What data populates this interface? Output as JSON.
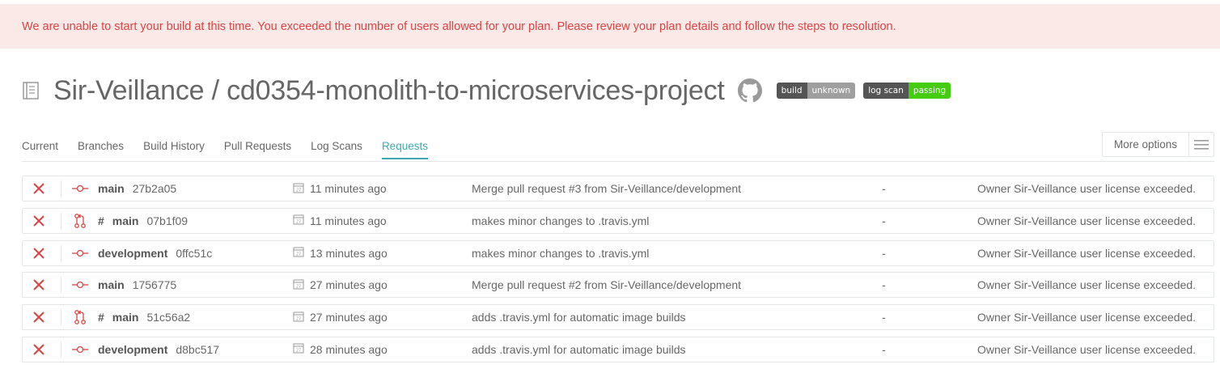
{
  "alert": {
    "message": "We are unable to start your build at this time. You exceeded the number of users allowed for your plan. Please review your plan details and follow the steps to resolution."
  },
  "header": {
    "title": "Sir-Veillance / cd0354-monolith-to-microservices-project",
    "badges": [
      {
        "key": "build",
        "value": "unknown",
        "color": "#9f9f9f"
      },
      {
        "key": "log scan",
        "value": "passing",
        "color": "#44cc11"
      }
    ]
  },
  "tabs": [
    {
      "label": "Current"
    },
    {
      "label": "Branches"
    },
    {
      "label": "Build History"
    },
    {
      "label": "Pull Requests"
    },
    {
      "label": "Log Scans"
    },
    {
      "label": "Requests",
      "active": true
    }
  ],
  "more_options": {
    "label": "More options"
  },
  "requests": [
    {
      "type": "push",
      "hash_prefix": "",
      "branch": "main",
      "commit": "27b2a05",
      "time": "11 minutes ago",
      "message": "Merge pull request #3 from Sir-Veillance/development",
      "pr": "-",
      "result": "Owner Sir-Veillance user license exceeded."
    },
    {
      "type": "pull_request",
      "hash_prefix": "#",
      "branch": "main",
      "commit": "07b1f09",
      "time": "11 minutes ago",
      "message": "makes minor changes to .travis.yml",
      "pr": "-",
      "result": "Owner Sir-Veillance user license exceeded."
    },
    {
      "type": "push",
      "hash_prefix": "",
      "branch": "development",
      "commit": "0ffc51c",
      "time": "13 minutes ago",
      "message": "makes minor changes to .travis.yml",
      "pr": "-",
      "result": "Owner Sir-Veillance user license exceeded."
    },
    {
      "type": "push",
      "hash_prefix": "",
      "branch": "main",
      "commit": "1756775",
      "time": "27 minutes ago",
      "message": "Merge pull request #2 from Sir-Veillance/development",
      "pr": "-",
      "result": "Owner Sir-Veillance user license exceeded."
    },
    {
      "type": "pull_request",
      "hash_prefix": "#",
      "branch": "main",
      "commit": "51c56a2",
      "time": "27 minutes ago",
      "message": "adds .travis.yml for automatic image builds",
      "pr": "-",
      "result": "Owner Sir-Veillance user license exceeded."
    },
    {
      "type": "push",
      "hash_prefix": "",
      "branch": "development",
      "commit": "d8bc517",
      "time": "28 minutes ago",
      "message": "adds .travis.yml for automatic image builds",
      "pr": "-",
      "result": "Owner Sir-Veillance user license exceeded."
    }
  ],
  "colors": {
    "accent": "#3eaaaf",
    "error": "#db4545",
    "alert_bg": "#fbe9e7"
  }
}
